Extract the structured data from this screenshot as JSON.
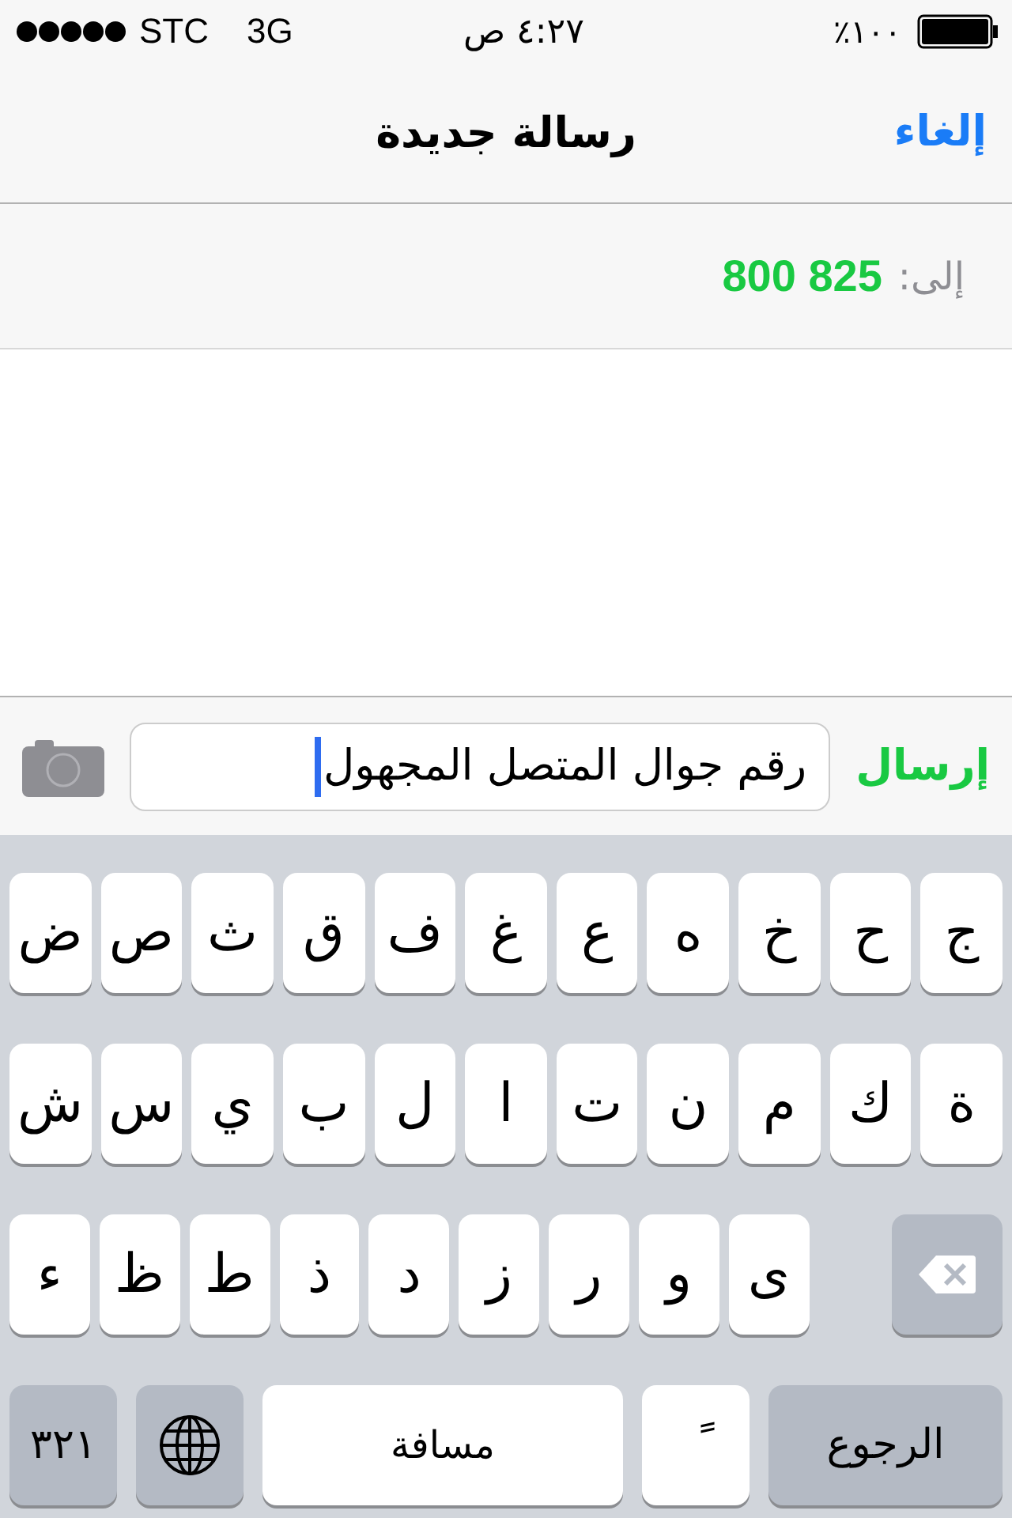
{
  "status_bar": {
    "carrier": "STC",
    "network": "3G",
    "time": "٤:٢٧ ص",
    "battery": "١٠٠٪"
  },
  "nav_bar": {
    "title": "رسالة جديدة",
    "cancel": "إلغاء"
  },
  "recipient": {
    "label": "إلى:",
    "value": "800 825"
  },
  "compose": {
    "value": "رقم جوال المتصل المجهول",
    "send": "إرسال"
  },
  "keyboard": {
    "rows": [
      {
        "keys": [
          {
            "kind": "letter",
            "label": "ج"
          },
          {
            "kind": "letter",
            "label": "ح"
          },
          {
            "kind": "letter",
            "label": "خ"
          },
          {
            "kind": "letter",
            "label": "ه"
          },
          {
            "kind": "letter",
            "label": "ع"
          },
          {
            "kind": "letter",
            "label": "غ"
          },
          {
            "kind": "letter",
            "label": "ف"
          },
          {
            "kind": "letter",
            "label": "ق"
          },
          {
            "kind": "letter",
            "label": "ث"
          },
          {
            "kind": "letter",
            "label": "ص"
          },
          {
            "kind": "letter",
            "label": "ض"
          }
        ]
      },
      {
        "keys": [
          {
            "kind": "letter",
            "label": "ة"
          },
          {
            "kind": "letter",
            "label": "ك"
          },
          {
            "kind": "letter",
            "label": "م"
          },
          {
            "kind": "letter",
            "label": "ن"
          },
          {
            "kind": "letter",
            "label": "ت"
          },
          {
            "kind": "letter",
            "label": "ا"
          },
          {
            "kind": "letter",
            "label": "ل"
          },
          {
            "kind": "letter",
            "label": "ب"
          },
          {
            "kind": "letter",
            "label": "ي"
          },
          {
            "kind": "letter",
            "label": "س"
          },
          {
            "kind": "letter",
            "label": "ش"
          }
        ]
      },
      {
        "keys": [
          {
            "kind": "delete"
          },
          {
            "kind": "letter",
            "label": "ى"
          },
          {
            "kind": "letter",
            "label": "و"
          },
          {
            "kind": "letter",
            "label": "ر"
          },
          {
            "kind": "letter",
            "label": "ز"
          },
          {
            "kind": "letter",
            "label": "د"
          },
          {
            "kind": "letter",
            "label": "ذ"
          },
          {
            "kind": "letter",
            "label": "ط"
          },
          {
            "kind": "letter",
            "label": "ظ"
          },
          {
            "kind": "letter",
            "label": "ء"
          }
        ]
      },
      {
        "keys": [
          {
            "kind": "return",
            "label": "الرجوع"
          },
          {
            "kind": "mark",
            "label": "ً"
          },
          {
            "kind": "space",
            "label": "مسافة"
          },
          {
            "kind": "globe"
          },
          {
            "kind": "numbers",
            "label": "٣٢١"
          }
        ]
      }
    ]
  }
}
